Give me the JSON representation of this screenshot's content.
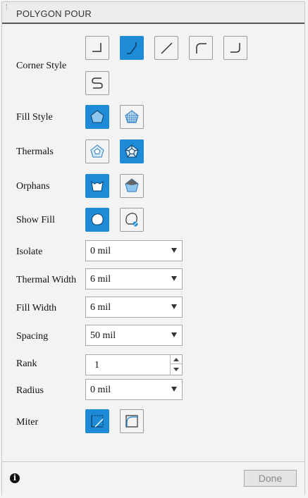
{
  "panel": {
    "title": "POLYGON POUR"
  },
  "labels": {
    "corner_style": "Corner Style",
    "fill_style": "Fill Style",
    "thermals": "Thermals",
    "orphans": "Orphans",
    "show_fill": "Show Fill",
    "isolate": "Isolate",
    "thermal_width": "Thermal Width",
    "fill_width": "Fill Width",
    "spacing": "Spacing",
    "rank": "Rank",
    "radius": "Radius",
    "miter": "Miter"
  },
  "fields": {
    "isolate": "0 mil",
    "thermal_width": "6 mil",
    "fill_width": "6 mil",
    "spacing": "50 mil",
    "rank": "1",
    "radius": "0 mil"
  },
  "corner_style_icons": [
    "corner-square-icon",
    "corner-diagonal-icon",
    "corner-slash-icon",
    "corner-arc-icon",
    "corner-round-icon",
    "corner-s-curve-icon"
  ],
  "selected": {
    "corner_style": "corner-diagonal-icon",
    "fill_style": "solid",
    "thermals": "on",
    "orphans": "remove",
    "show_fill": "on",
    "miter": "square"
  },
  "colors": {
    "accent": "#1e8bd6",
    "panel_bg": "#f3f3f3"
  },
  "footer": {
    "info_symbol": "i",
    "done_label": "Done"
  }
}
